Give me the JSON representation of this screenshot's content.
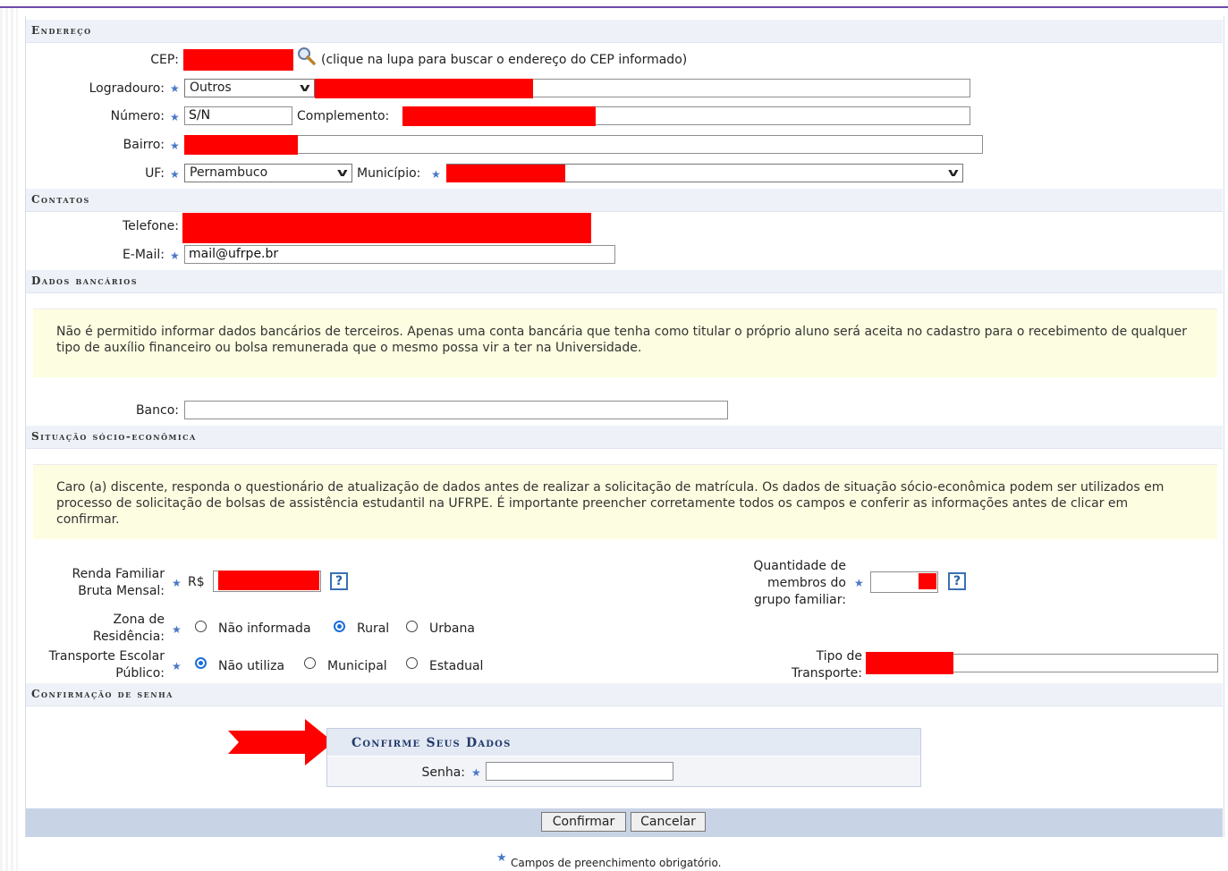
{
  "sections": {
    "endereco": "Endereço",
    "contatos": "Contatos",
    "dados_bancarios": "Dados bancários",
    "situacao": "Situação sócio-econômica",
    "confirmacao": "Confirmação de senha"
  },
  "endereco": {
    "cep_label": "CEP:",
    "cep_hint": "(clique na lupa para buscar o endereço do CEP informado)",
    "logradouro_label": "Logradouro:",
    "logradouro_type": "Outros",
    "numero_label": "Número:",
    "numero_value": "S/N",
    "complemento_label": "Complemento:",
    "bairro_label": "Bairro:",
    "uf_label": "UF:",
    "uf_value": "Pernambuco",
    "municipio_label": "Município:"
  },
  "contatos": {
    "telefone_label": "Telefone:",
    "email_label": "E-Mail:",
    "email_value": "mail@ufrpe.br"
  },
  "bancarios": {
    "note": "Não é permitido informar dados bancários de terceiros. Apenas uma conta bancária que tenha como titular o próprio aluno será aceita no cadastro para o recebimento de qualquer tipo de auxílio financeiro ou bolsa remunerada que o mesmo possa vir a ter na Universidade.",
    "banco_label": "Banco:"
  },
  "situacao": {
    "note": "Caro (a) discente, responda o questionário de atualização de dados antes de realizar a solicitação de matrícula. Os dados de situação sócio-econômica podem ser utilizados em processo de solicitação de bolsas de assistência estudantil na UFRPE. É importante preencher corretamente todos os campos e conferir as informações antes de clicar em confirmar.",
    "renda_label_1": "Renda Familiar",
    "renda_label_2": "Bruta Mensal:",
    "currency": "R$",
    "membros_label_1": "Quantidade de",
    "membros_label_2": "membros do",
    "membros_label_3": "grupo familiar:",
    "zona_label_1": "Zona de",
    "zona_label_2": "Residência:",
    "zona_options": [
      "Não informada",
      "Rural",
      "Urbana"
    ],
    "zona_selected": "Rural",
    "transporte_label_1": "Transporte Escolar",
    "transporte_label_2": "Público:",
    "transporte_options": [
      "Não utiliza",
      "Municipal",
      "Estadual"
    ],
    "transporte_selected": "Não utiliza",
    "tipo_label_1": "Tipo de",
    "tipo_label_2": "Transporte:",
    "help_glyph": "?"
  },
  "confirm": {
    "box_title": "Confirme Seus Dados",
    "senha_label": "Senha:",
    "confirm_button": "Confirmar",
    "cancel_button": "Cancelar",
    "footer_note": "Campos de preenchimento obrigatório."
  },
  "icons": {
    "required": "required-star-icon",
    "search": "magnifier-icon",
    "help": "help-icon",
    "arrow": "red-arrow-icon"
  },
  "colors": {
    "section_bg": "#eef2f8",
    "note_bg": "#fdfde1",
    "redaction": "#ff0000",
    "accent_blue": "#4a78c6",
    "button_bar": "#c8d3e6"
  }
}
